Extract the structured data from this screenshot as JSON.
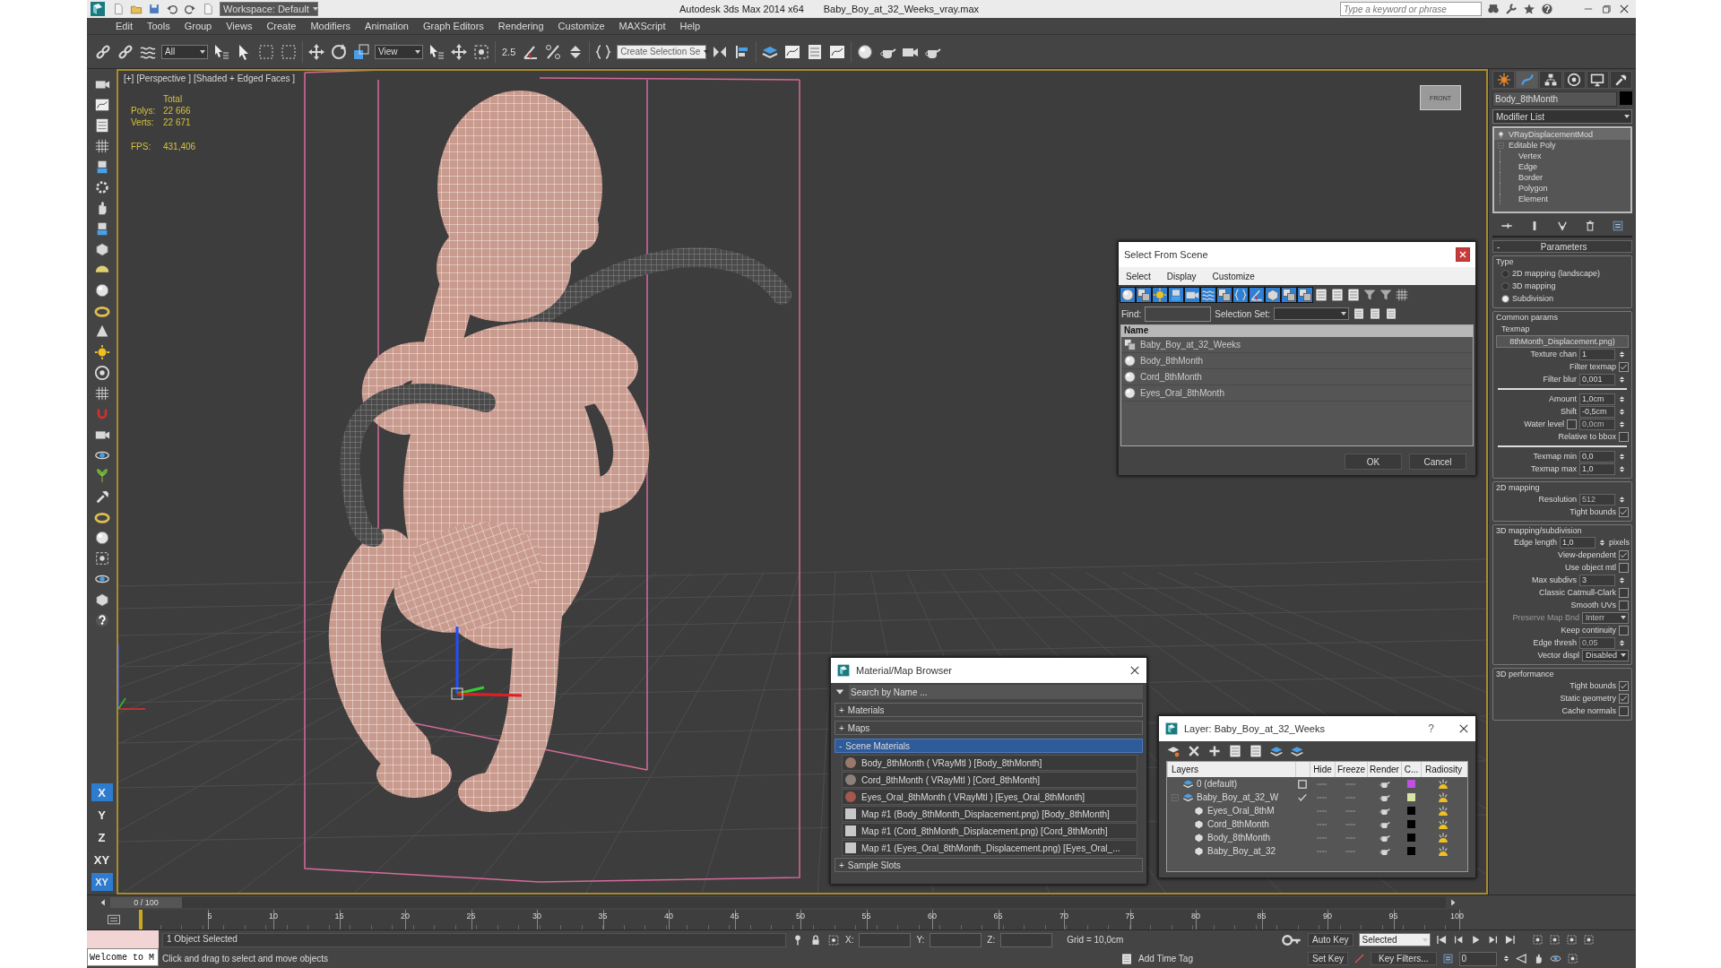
{
  "title_bar": {
    "workspace": "Workspace: Default",
    "app": "Autodesk 3ds Max  2014 x64",
    "file": "Baby_Boy_at_32_Weeks_vray.max",
    "search": {
      "placeholder": "Type a keyword or phrase"
    }
  },
  "menu": [
    "Edit",
    "Tools",
    "Group",
    "Views",
    "Create",
    "Modifiers",
    "Animation",
    "Graph Editors",
    "Rendering",
    "Customize",
    "MAXScript",
    "Help"
  ],
  "toolbar": {
    "selection_filter": "All",
    "reference_coord": "View",
    "snap_label": "2.5",
    "named_selection": "Create Selection Se"
  },
  "left_toolbar": {
    "axis_buttons": [
      {
        "label": "X",
        "selected": true
      },
      {
        "label": "Y",
        "selected": false
      },
      {
        "label": "Z",
        "selected": false
      },
      {
        "label": "XY",
        "selected": false
      }
    ],
    "snap_button": {
      "label": "XY",
      "on": true
    }
  },
  "viewport": {
    "labels": [
      "[+]",
      "[Perspective ]",
      "[Shaded + Edged Faces ]"
    ],
    "stats": {
      "header": "Total",
      "rows": [
        {
          "label": "Polys:",
          "value": "22 666"
        },
        {
          "label": "Verts:",
          "value": "22 671"
        }
      ],
      "fps": {
        "label": "FPS:",
        "value": "431,406"
      }
    },
    "viewcube": "FRONT"
  },
  "select_dialog": {
    "title": "Select From Scene",
    "menu": [
      "Select",
      "Display",
      "Customize"
    ],
    "find_label": "Find:",
    "selection_set_label": "Selection Set:",
    "column": "Name",
    "rows": [
      {
        "kind": "group",
        "name": "Baby_Boy_at_32_Weeks",
        "selected": false
      },
      {
        "kind": "object",
        "name": "Body_8thMonth",
        "selected": false
      },
      {
        "kind": "object",
        "name": "Cord_8thMonth",
        "selected": false
      },
      {
        "kind": "object",
        "name": "Eyes_Oral_8thMonth",
        "selected": false
      }
    ],
    "buttons": [
      "OK",
      "Cancel"
    ]
  },
  "material_browser": {
    "title": "Material/Map Browser",
    "search": {
      "placeholder": "Search by Name ..."
    },
    "sections": [
      {
        "toggle": "+",
        "label": "Materials",
        "expanded": false
      },
      {
        "toggle": "+",
        "label": "Maps",
        "expanded": false
      },
      {
        "toggle": "-",
        "label": "Scene Materials",
        "expanded": true,
        "items": [
          {
            "kind": "material",
            "color": "#9a786c",
            "label": "Body_8thMonth ( VRayMtl ) [Body_8thMonth]"
          },
          {
            "kind": "material",
            "color": "#8c817a",
            "label": "Cord_8thMonth ( VRayMtl ) [Cord_8thMonth]"
          },
          {
            "kind": "material",
            "color": "#a5584c",
            "label": "Eyes_Oral_8thMonth ( VRayMtl ) [Eyes_Oral_8thMonth]"
          },
          {
            "kind": "map",
            "color": "#c8c8c8",
            "label": "Map #1 (Body_8thMonth_Displacement.png) [Body_8thMonth]"
          },
          {
            "kind": "map",
            "color": "#c8c8c8",
            "label": "Map #1 (Cord_8thMonth_Displacement.png) [Cord_8thMonth]"
          },
          {
            "kind": "map",
            "color": "#c8c8c8",
            "label": "Map #1 (Eyes_Oral_8thMonth_Displacement.png) [Eyes_Oral_..."
          }
        ]
      },
      {
        "toggle": "+",
        "label": "Sample Slots",
        "expanded": false
      }
    ]
  },
  "layer_dialog": {
    "title": "Layer: Baby_Boy_at_32_Weeks",
    "help": "?",
    "columns": [
      "Layers",
      "Hide",
      "Freeze",
      "Render",
      "C...",
      "Radiosity"
    ],
    "layers": [
      {
        "kind": "layer",
        "name": "0 (default)",
        "current": false,
        "color": "#c050e0"
      },
      {
        "kind": "layer",
        "name": "Baby_Boy_at_32_W",
        "current": true,
        "expanded": true,
        "color": "#d8e4a0",
        "children": [
          {
            "kind": "object",
            "name": "Eyes_Oral_8thM",
            "color": "#000000"
          },
          {
            "kind": "object",
            "name": "Cord_8thMonth",
            "color": "#000000"
          },
          {
            "kind": "object",
            "name": "Body_8thMonth",
            "color": "#000000"
          },
          {
            "kind": "object",
            "name": "Baby_Boy_at_32",
            "color": "#000000"
          }
        ]
      }
    ]
  },
  "command_panel": {
    "tabs": [
      {
        "selected": false
      },
      {
        "selected": true
      },
      {
        "selected": false
      },
      {
        "selected": false
      },
      {
        "selected": false
      },
      {
        "selected": false
      }
    ],
    "object_name": "Body_8thMonth",
    "modifier_list": "Modifier List",
    "stack": [
      {
        "name": "VRayDisplacementMod",
        "selected": true
      },
      {
        "name": "Editable Poly",
        "selected": false,
        "expanded": true,
        "children": [
          {
            "name": "Vertex",
            "selected": false
          },
          {
            "name": "Edge",
            "selected": false
          },
          {
            "name": "Border",
            "selected": false
          },
          {
            "name": "Polygon",
            "selected": false
          },
          {
            "name": "Element",
            "selected": false
          }
        ]
      }
    ],
    "rollout": {
      "toggle": "-",
      "title": "Parameters",
      "groups": [
        {
          "title": "Type",
          "rows": [
            {
              "kind": "radio",
              "label": "2D mapping (landscape)",
              "selected": false
            },
            {
              "kind": "radio",
              "label": "3D mapping",
              "selected": false
            },
            {
              "kind": "radio",
              "label": "Subdivision",
              "selected": true
            }
          ]
        },
        {
          "title": "Common params",
          "rows": [
            {
              "kind": "label",
              "label": "Texmap"
            },
            {
              "kind": "button",
              "label": "8thMonth_Displacement.png)"
            },
            {
              "kind": "spinner",
              "label": "Texture chan",
              "value": "1"
            },
            {
              "kind": "checkbox",
              "label": "Filter texmap",
              "checked": true
            },
            {
              "kind": "spinner",
              "label": "Filter blur",
              "value": "0,001"
            },
            {
              "kind": "separator"
            },
            {
              "kind": "spinner",
              "label": "Amount",
              "value": "1,0cm"
            },
            {
              "kind": "spinner",
              "label": "Shift",
              "value": "-0,5cm"
            },
            {
              "kind": "spinner",
              "label": "Water level",
              "value": "0,0cm",
              "checked": false,
              "disabled": true
            },
            {
              "kind": "checkbox",
              "label": "Relative to bbox",
              "checked": false
            },
            {
              "kind": "separator"
            },
            {
              "kind": "spinner",
              "label": "Texmap min",
              "value": "0,0"
            },
            {
              "kind": "spinner",
              "label": "Texmap max",
              "value": "1,0"
            }
          ]
        },
        {
          "title": "2D mapping",
          "rows": [
            {
              "kind": "spinner",
              "label": "Resolution",
              "value": "512",
              "disabled": true
            },
            {
              "kind": "checkbox",
              "label": "Tight bounds",
              "checked": true
            }
          ]
        },
        {
          "title": "3D mapping/subdivision",
          "rows": [
            {
              "kind": "spinner",
              "label": "Edge length",
              "value": "1,0",
              "suffix": "pixels"
            },
            {
              "kind": "checkbox",
              "label": "View-dependent",
              "checked": true
            },
            {
              "kind": "checkbox",
              "label": "Use object mtl",
              "checked": false
            },
            {
              "kind": "spinner",
              "label": "Max subdivs",
              "value": "3"
            },
            {
              "kind": "checkbox",
              "label": "Classic Catmull-Clark",
              "checked": false
            },
            {
              "kind": "checkbox",
              "label": "Smooth UVs",
              "checked": false
            },
            {
              "kind": "dropdown",
              "label": "Preserve Map Bnd",
              "value": "Interr",
              "disabled": true
            },
            {
              "kind": "checkbox",
              "label": "Keep continuity",
              "checked": false
            },
            {
              "kind": "spinner",
              "label": "Edge thresh",
              "value": "0,05",
              "disabled": true
            },
            {
              "kind": "dropdown",
              "label": "Vector displ",
              "value": "Disabled"
            }
          ]
        },
        {
          "title": "3D performance",
          "rows": [
            {
              "kind": "checkbox",
              "label": "Tight bounds",
              "checked": true
            },
            {
              "kind": "checkbox",
              "label": "Static geometry",
              "checked": true
            },
            {
              "kind": "checkbox",
              "label": "Cache normals",
              "checked": false
            }
          ]
        }
      ]
    }
  },
  "timeline": {
    "frame": "0 / 100",
    "level": 0,
    "ticks": [
      "5",
      "10",
      "15",
      "20",
      "25",
      "30",
      "35",
      "40",
      "45",
      "50",
      "55",
      "60",
      "65",
      "70",
      "75",
      "80",
      "85",
      "90",
      "95",
      "100"
    ]
  },
  "status_bar": {
    "listener": "Welcome to M",
    "selection": "1 Object Selected",
    "prompt": "Click and drag to select and move objects",
    "coords": [
      "X:",
      "Y:",
      "Z:"
    ],
    "grid": "Grid = 10,0cm",
    "time_tag": "Add Time Tag",
    "auto_key": {
      "label": "Auto Key",
      "on": false
    },
    "set_key": "Set Key",
    "key_mode": "Selected",
    "key_filters": "Key Filters...",
    "frame": "0"
  }
}
